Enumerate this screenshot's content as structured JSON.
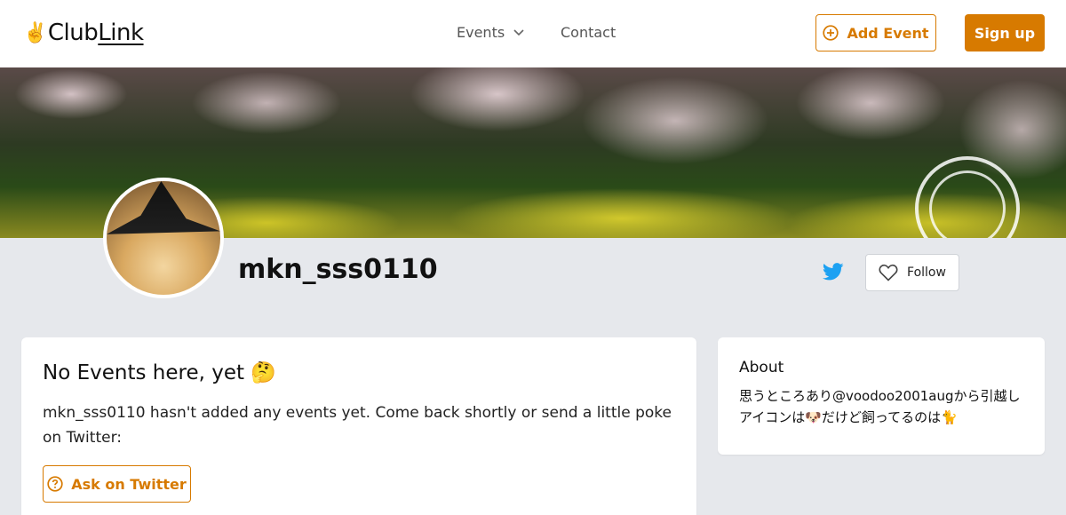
{
  "navbar": {
    "logo_emoji": "✌️",
    "logo_club": "Club",
    "logo_link": "Link",
    "events_label": "Events",
    "contact_label": "Contact",
    "add_event_label": "Add Event",
    "signup_label": "Sign up"
  },
  "profile": {
    "username": "mkn_sss0110",
    "follow_label": "Follow"
  },
  "events_card": {
    "title": "No Events here, yet 🤔",
    "message": "mkn_sss0110 hasn't added any events yet. Come back shortly or send a little poke on Twitter:",
    "ask_label": "Ask on Twitter"
  },
  "about_card": {
    "title": "About",
    "text": "思うところあり@voodoo2001augから引越し アイコンは🐶だけど飼ってるのは🐈"
  },
  "colors": {
    "accent": "#d77a00",
    "twitter": "#1da1f2",
    "background": "#e6e8ec"
  },
  "icons": [
    "chevron-down-icon",
    "plus-circle-icon",
    "twitter-icon",
    "heart-icon",
    "question-circle-icon"
  ]
}
